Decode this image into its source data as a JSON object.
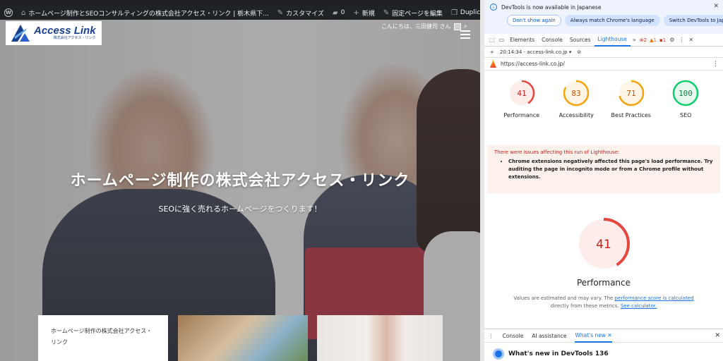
{
  "wp_admin_bar": {
    "site_title": "ホームページ制作とSEOコンサルティングの株式会社アクセス・リンク | 栃木県下...",
    "customize": "カスタマイズ",
    "comments_count": "0",
    "new": "新規",
    "edit_page": "固定ページを編集",
    "duplicate": "Duplicate Post"
  },
  "site": {
    "logo_brand": "Access Link",
    "logo_sub": "株式会社アクセス・リンク",
    "greeting": "こんにちは、三田健司 さん",
    "hero_title": "ホームページ制作の株式会社アクセス・リンク",
    "hero_subtitle": "SEOに強く売れるホームページをつくります！",
    "card1_text": "ホームページ制作の株式会社アクセス・リンク"
  },
  "devtools": {
    "infobar": {
      "message": "DevTools is now available in Japanese",
      "btn_dont_show": "Don't show again",
      "btn_match": "Always match Chrome's language",
      "btn_switch": "Switch DevTools to Japanese"
    },
    "tabs": [
      "Elements",
      "Console",
      "Sources",
      "Lighthouse"
    ],
    "active_tab": "Lighthouse",
    "errors": "2",
    "warnings": "1",
    "issues": "1",
    "report_time": "20:14:34 - access-link.co.jp",
    "url": "https://access-link.co.jp/",
    "scores": [
      {
        "label": "Performance",
        "value": 41,
        "color": "#e8453c",
        "bg": "#fdecea"
      },
      {
        "label": "Accessibility",
        "value": 83,
        "color": "#f4a30a",
        "bg": "#fef5e6"
      },
      {
        "label": "Best Practices",
        "value": 71,
        "color": "#f4a30a",
        "bg": "#fef5e6"
      },
      {
        "label": "SEO",
        "value": 100,
        "color": "#0cce6b",
        "bg": "#e7f9ee"
      }
    ],
    "warning_title": "There were issues affecting this run of Lighthouse:",
    "warning_item": "Chrome extensions negatively affected this page's load performance. Try auditing the page in incognito mode or from a Chrome profile without extensions.",
    "big_score": "41",
    "big_title": "Performance",
    "note_1": "Values are estimated and may vary. The",
    "note_link1": "performance score is calculated",
    "note_2": "directly from these metrics.",
    "note_link2": "See calculator.",
    "drawer_tabs": [
      "Console",
      "AI assistance",
      "What's new"
    ],
    "whats_new_title": "What's new in DevTools 136"
  },
  "colors": {
    "wp_bar": "#1d2327",
    "brand_blue": "#1b3f8f",
    "accent_blue": "#1a73e8",
    "fail_red": "#e8453c",
    "average_orange": "#f4a30a",
    "pass_green": "#0cce6b"
  }
}
